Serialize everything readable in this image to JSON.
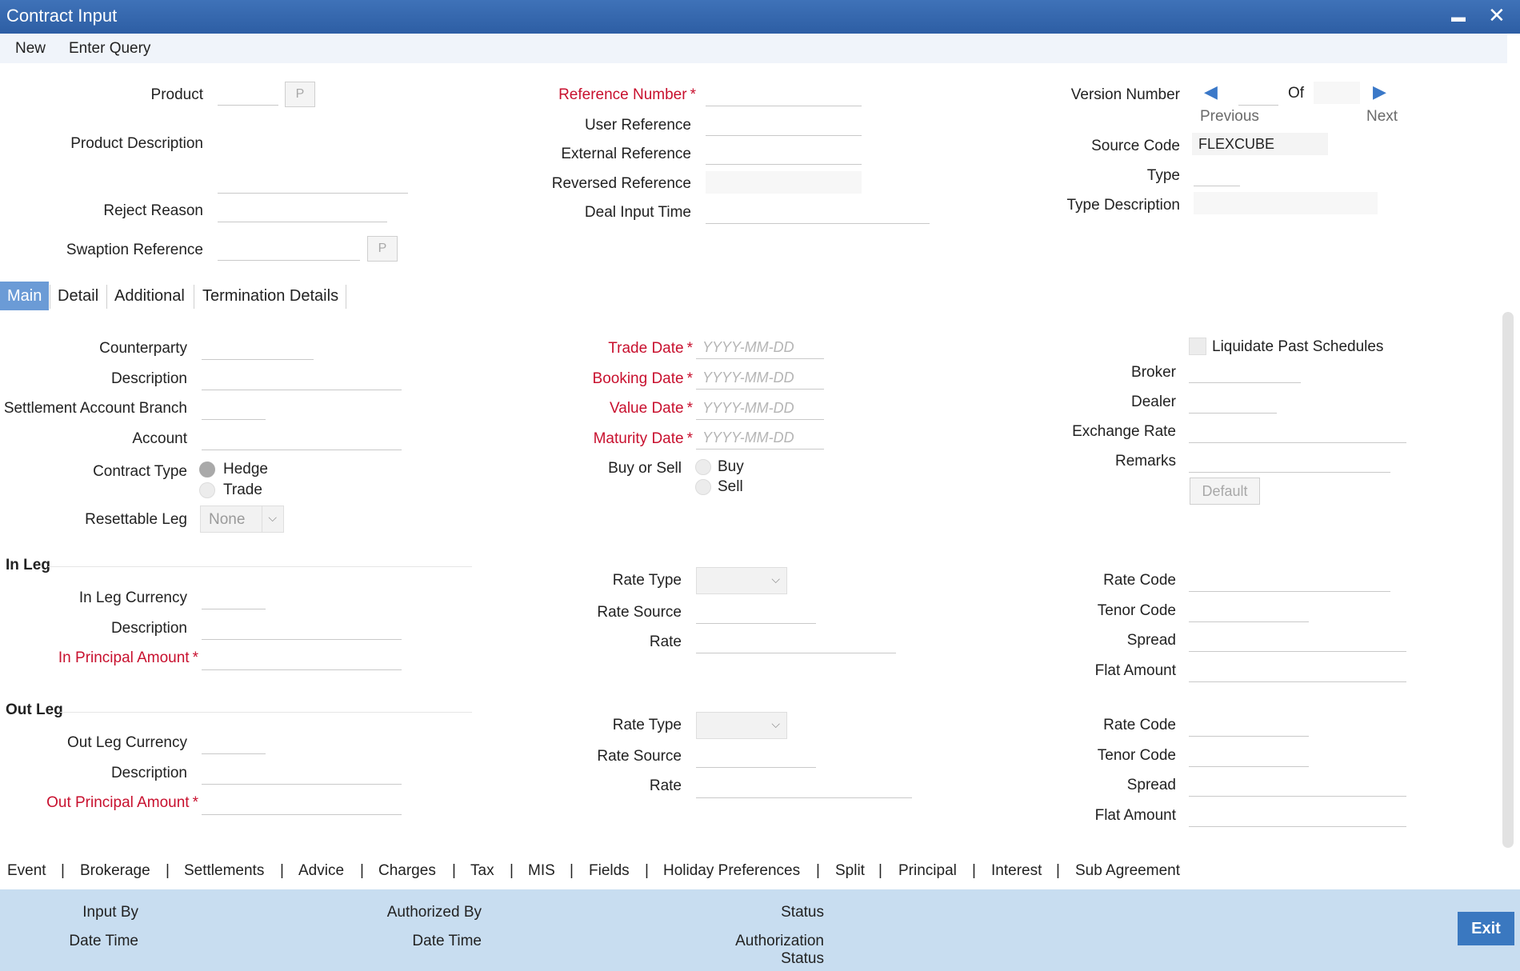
{
  "window": {
    "title": "Contract Input",
    "minimize_glyph": "▬",
    "close_glyph": "✕"
  },
  "menu": {
    "new": "New",
    "enter_query": "Enter Query"
  },
  "header": {
    "product_label": "Product",
    "product_lov": "P",
    "product_description_label": "Product Description",
    "reject_reason_label": "Reject Reason",
    "swaption_reference_label": "Swaption Reference",
    "swaption_lov": "P",
    "reference_number_label": "Reference Number",
    "user_reference_label": "User Reference",
    "external_reference_label": "External Reference",
    "reversed_reference_label": "Reversed Reference",
    "deal_input_time_label": "Deal Input Time",
    "version_number_label": "Version Number",
    "of_label": "Of",
    "previous_label": "Previous",
    "next_label": "Next",
    "source_code_label": "Source Code",
    "source_code_value": "FLEXCUBE",
    "type_label": "Type",
    "type_description_label": "Type Description",
    "required_star": "*"
  },
  "tabs": [
    {
      "label": "Main",
      "active": true
    },
    {
      "label": "Detail",
      "active": false
    },
    {
      "label": "Additional",
      "active": false
    },
    {
      "label": "Termination Details",
      "active": false
    }
  ],
  "main": {
    "counterparty_label": "Counterparty",
    "description_label": "Description",
    "settlement_account_branch_label": "Settlement Account Branch",
    "account_label": "Account",
    "contract_type_label": "Contract Type",
    "contract_type_options": [
      "Hedge",
      "Trade"
    ],
    "resettable_leg_label": "Resettable Leg",
    "resettable_leg_value": "None",
    "trade_date_label": "Trade Date",
    "booking_date_label": "Booking Date",
    "value_date_label": "Value Date",
    "maturity_date_label": "Maturity Date",
    "date_placeholder": "YYYY-MM-DD",
    "buy_or_sell_label": "Buy or Sell",
    "buy_sell_options": [
      "Buy",
      "Sell"
    ],
    "liquidate_past_schedules_label": "Liquidate Past Schedules",
    "broker_label": "Broker",
    "dealer_label": "Dealer",
    "exchange_rate_label": "Exchange Rate",
    "remarks_label": "Remarks",
    "default_button": "Default"
  },
  "in_leg": {
    "title": "In Leg",
    "currency_label": "In Leg Currency",
    "description_label": "Description",
    "principal_label": "In Principal Amount",
    "rate_type_label": "Rate Type",
    "rate_source_label": "Rate Source",
    "rate_label": "Rate",
    "rate_code_label": "Rate Code",
    "tenor_code_label": "Tenor Code",
    "spread_label": "Spread",
    "flat_amount_label": "Flat Amount"
  },
  "out_leg": {
    "title": "Out Leg",
    "currency_label": "Out Leg Currency",
    "description_label": "Description",
    "principal_label": "Out Principal Amount",
    "rate_type_label": "Rate Type",
    "rate_source_label": "Rate Source",
    "rate_label": "Rate",
    "rate_code_label": "Rate Code",
    "tenor_code_label": "Tenor Code",
    "spread_label": "Spread",
    "flat_amount_label": "Flat Amount"
  },
  "bottom_tabs": [
    "Event",
    "Brokerage",
    "Settlements",
    "Advice",
    "Charges",
    "Tax",
    "MIS",
    "Fields",
    "Holiday Preferences",
    "Split",
    "Principal",
    "Interest",
    "Sub Agreement"
  ],
  "separator": "|",
  "footer": {
    "input_by": "Input By",
    "date_time_1": "Date Time",
    "authorized_by": "Authorized By",
    "date_time_2": "Date Time",
    "status": "Status",
    "authorization": "Authorization",
    "authorization_status": "Status",
    "exit": "Exit"
  }
}
